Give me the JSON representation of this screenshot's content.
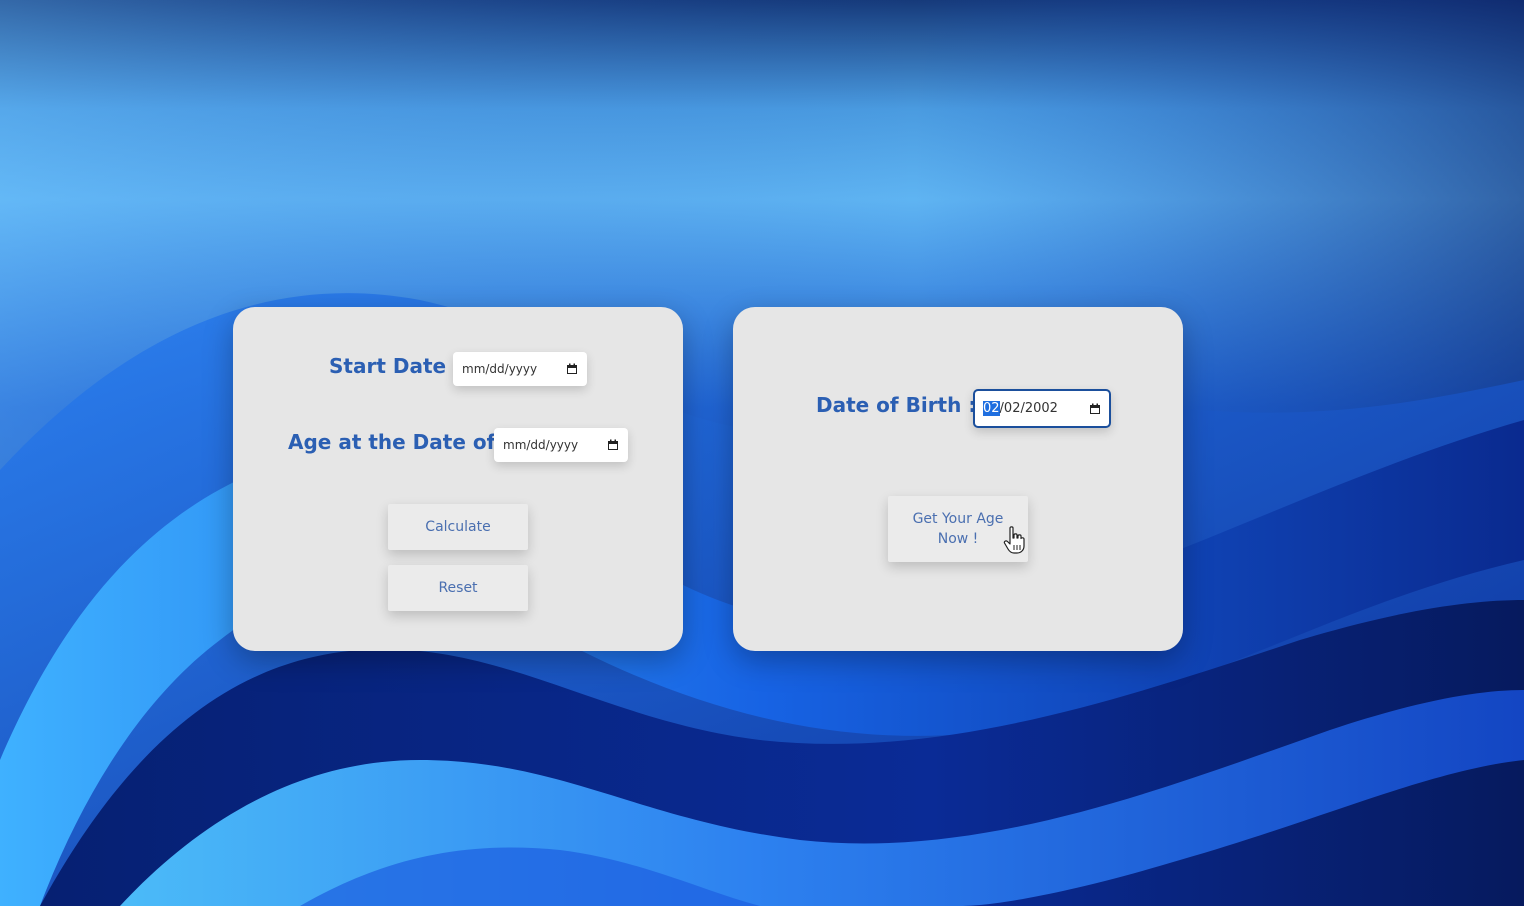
{
  "colors": {
    "label": "#2b5fb3",
    "button_text": "#4a6fb0",
    "card_bg": "#e6e6e6",
    "focus_border": "#1b4f9c",
    "selection": "#1f6fe0"
  },
  "age_calculator": {
    "start_date": {
      "label": "Start Date :",
      "placeholder": "mm/dd/yyyy",
      "icon": "calendar-icon"
    },
    "age_at_date": {
      "label": "Age at the Date of :",
      "placeholder": "mm/dd/yyyy",
      "icon": "calendar-icon"
    },
    "calculate_label": "Calculate",
    "reset_label": "Reset"
  },
  "birth_age": {
    "dob": {
      "label": "Date of Birth :",
      "month": "02",
      "rest": "/02/2002",
      "icon": "calendar-icon"
    },
    "button_line1": "Get Your Age",
    "button_line2": "Now !"
  }
}
